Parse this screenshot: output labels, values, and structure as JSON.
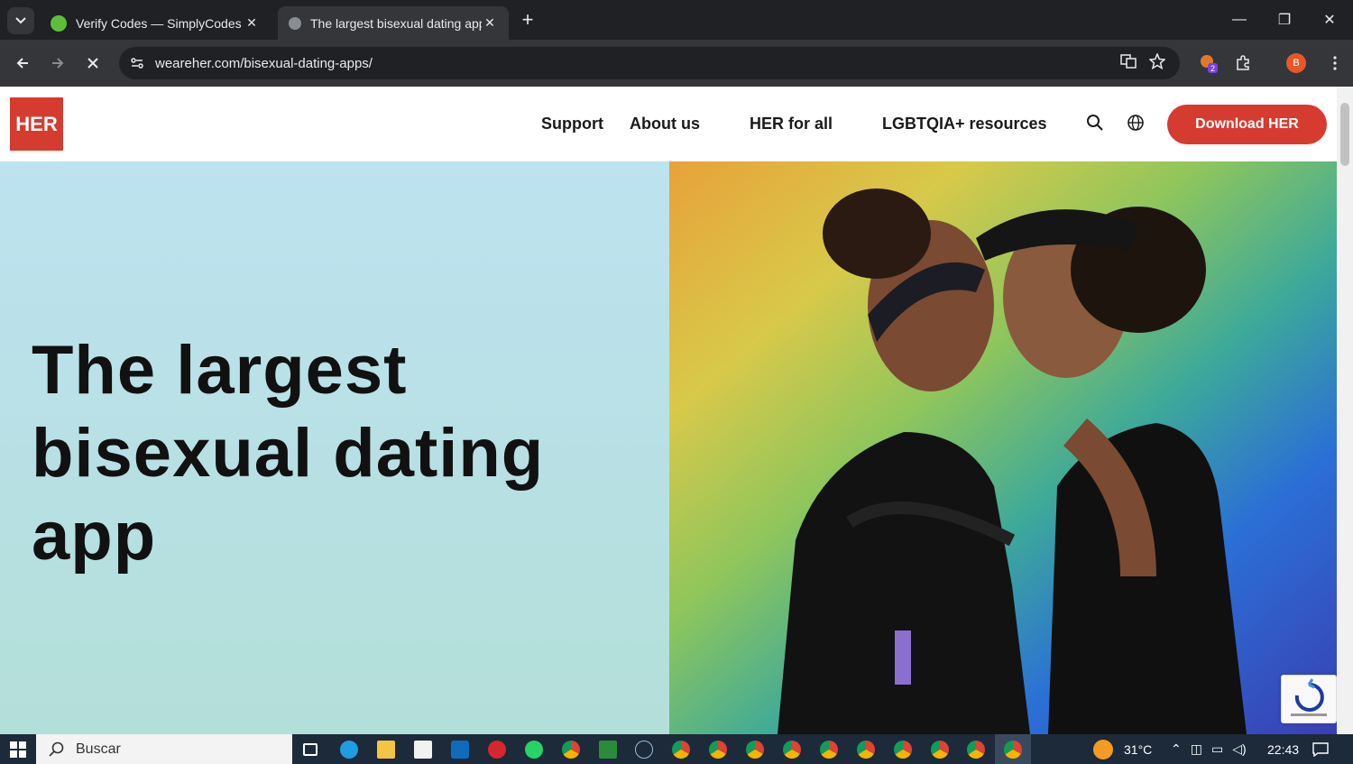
{
  "browser": {
    "tabs": [
      {
        "title": "Verify Codes — SimplyCodes",
        "favicon_color": "#5cbf3a"
      },
      {
        "title": "The largest bisexual dating app",
        "favicon_color": "#8a8d91"
      }
    ],
    "url": "weareher.com/bisexual-dating-apps/",
    "extension_badge": "2",
    "profile_initial": "B"
  },
  "site": {
    "logo_text": "HER",
    "nav": [
      "Support",
      "About us",
      "HER for all",
      "LGBTQIA+ resources"
    ],
    "cta_label": "Download HER",
    "hero_title": "The largest bisexual dating app",
    "brand_color": "#d63b2f"
  },
  "taskbar": {
    "search_placeholder": "Buscar",
    "weather_temp": "31°C",
    "time": "22:43"
  }
}
